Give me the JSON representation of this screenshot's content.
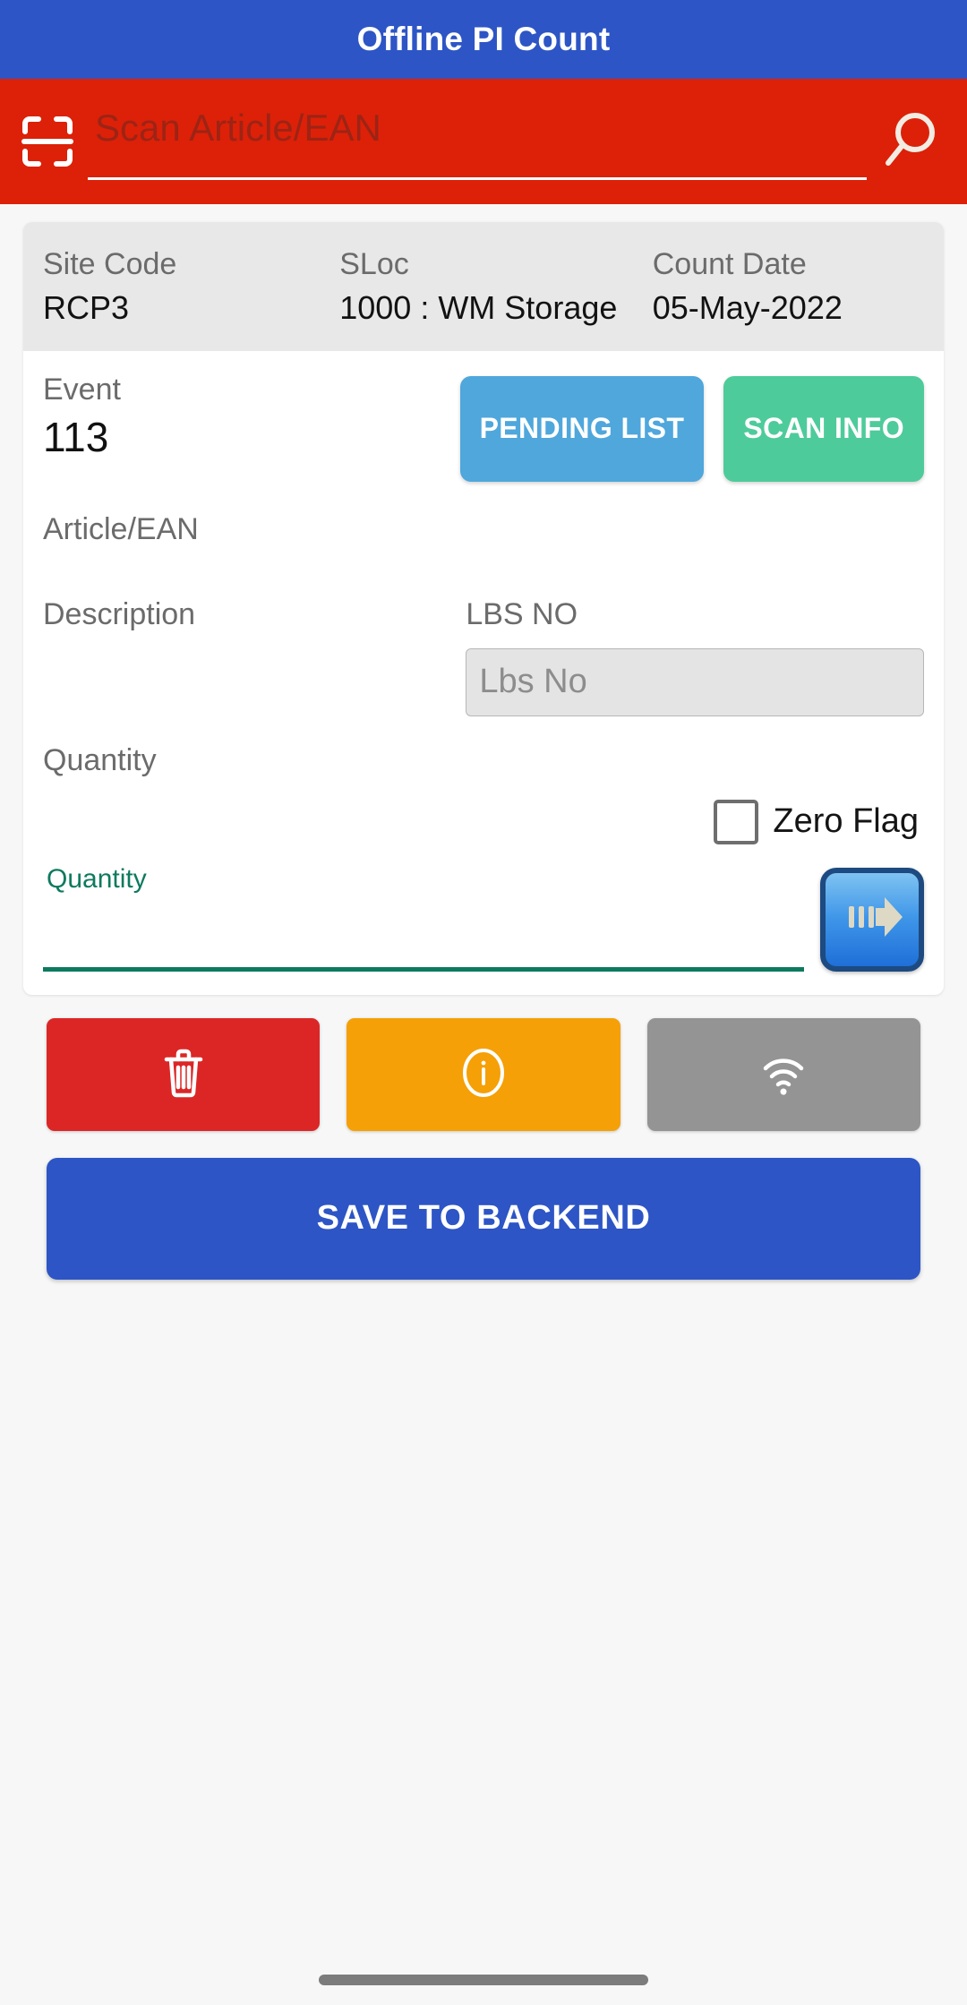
{
  "appbar": {
    "title": "Offline PI Count"
  },
  "search": {
    "scan_icon": "barcode-scan-icon",
    "placeholder": "Scan Article/EAN",
    "value": "",
    "search_icon": "search-icon"
  },
  "info_strip": {
    "columns": [
      {
        "label": "Site Code",
        "value": "RCP3"
      },
      {
        "label": "SLoc",
        "value": "1000 : WM Storage"
      },
      {
        "label": "Count Date",
        "value": "05-May-2022"
      }
    ]
  },
  "event": {
    "label": "Event",
    "value": "113"
  },
  "buttons": {
    "pending_list": "PENDING LIST",
    "scan_info": "SCAN INFO"
  },
  "fields": {
    "article_label": "Article/EAN",
    "article_value": "",
    "description_label": "Description",
    "description_value": "",
    "lbs_no_label": "LBS NO",
    "lbs_no_placeholder": "Lbs No",
    "lbs_no_value": "",
    "quantity_label": "Quantity",
    "quantity_float_label": "Quantity",
    "quantity_value": "",
    "quantity_placeholder": ""
  },
  "zero_flag": {
    "label": "Zero Flag",
    "checked": false
  },
  "submit_arrow": {
    "icon": "arrow-right-motion-icon"
  },
  "actions": [
    {
      "name": "delete",
      "icon": "trash-icon",
      "color": "#dc2626"
    },
    {
      "name": "info",
      "icon": "info-circle-icon",
      "color": "#f5a006"
    },
    {
      "name": "connectivity",
      "icon": "wifi-icon",
      "color": "#949494"
    }
  ],
  "save": {
    "label": "SAVE TO BACKEND"
  },
  "colors": {
    "appbar": "#2d55c5",
    "searchbar": "#dc2108",
    "pending_list": "#4fa7dc",
    "scan_info": "#4ecb9b",
    "quantity_accent": "#0d7a5f",
    "save": "#2d55c5"
  }
}
